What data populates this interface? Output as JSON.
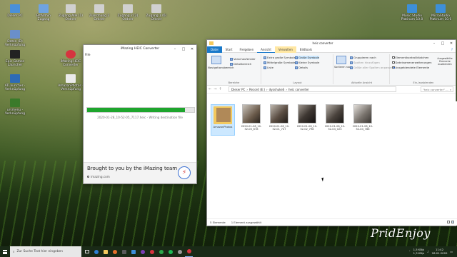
{
  "desktop": {
    "icons": [
      {
        "label": "Dieser PC",
        "color": "#4a90d9"
      },
      {
        "label": "BitAdmin Zugang",
        "color": "#6fa3e0"
      },
      {
        "label": "Zugang Alle (1) Ordner",
        "color": "#d0d0d0"
      },
      {
        "label": "Zuordnung 2 Ordner",
        "color": "#d0d0d0"
      },
      {
        "label": "Zugang 2 (2) Ordner",
        "color": "#d0d0d0"
      },
      {
        "label": "Zugang 1 (6) Ordner",
        "color": "#d0d0d0"
      },
      {
        "label": "Daten (D) Verknüpfung",
        "color": "#6a8fc9"
      },
      {
        "label": "Epic Games Launcher",
        "color": "#222222"
      },
      {
        "label": "iMazing HEIC Converter",
        "color": "#d6343f"
      },
      {
        "label": "ATLauncher - Verknüpfung",
        "color": "#2e6bb5"
      },
      {
        "label": "AmazonPhotos - Verknüpfung",
        "color": "#eaeaea"
      },
      {
        "label": "ursmenu - Verknüpfung",
        "color": "#3a7a2a"
      },
      {
        "label": "Music Studio Platinum 10.0",
        "color": "#3d8fd9"
      },
      {
        "label": "MicroStudio Platinum 10.0",
        "color": "#3d8fd9"
      }
    ]
  },
  "imazing": {
    "title": "iMazing HEIC Converter",
    "menu_file": "File",
    "progress": 0.91,
    "status": "2020-01-28_10-52-05_7117.heic - Writing destination file",
    "brought": "Brought to you by the iMazing team",
    "site": "imazing.com",
    "accent": "#1ea52d"
  },
  "explorer": {
    "title": "heic converter",
    "tabs": {
      "file": "Datei",
      "start": "Start",
      "share": "Freigeben",
      "view": "Ansicht",
      "manage": "Verwalten",
      "pictools": "Bildtools"
    },
    "ribbon": {
      "nav_pane": "Navigationsbereich",
      "preview": "Vorschaufenster",
      "details_pane": "Detailbereich",
      "xl_icons": "Extra große Symbole",
      "l_icons": "Große Symbole",
      "m_icons": "Mittelgroße Symbole",
      "s_icons": "Kleine Symbole",
      "list": "Liste",
      "details": "Details",
      "sort": "Sortieren nach",
      "group": "Gruppieren nach",
      "add_cols": "Spalten hinzufügen",
      "fit_cols": "Größe aller Spalten anpassen",
      "chk_boxes": "Elementkontrollkästchen",
      "ext": "Dateinamenerweiterungen",
      "hidden": "Ausgeblendete Elemente",
      "hide_sel": "Ausgewählte Elemente ausblenden",
      "options": "Optionen",
      "g_panes": "Bereiche",
      "g_layout": "Layout",
      "g_view": "Aktuelle Ansicht",
      "g_show": "Ein-/ausblenden"
    },
    "breadcrumb": [
      "Dieser PC",
      "Record (E:)",
      "dyoshukeS",
      "heic converter"
    ],
    "search_placeholder": "\"heic converter\" ...",
    "items": [
      {
        "name": "AmazonPhotos",
        "type": "folder"
      },
      {
        "name": "2020-01-28_10-52-00_678",
        "type": "image",
        "tone": "#6a5a4a"
      },
      {
        "name": "2020-01-28_10-52-01_747",
        "type": "image",
        "tone": "#5a4d42"
      },
      {
        "name": "2020-01-28_10-52-02_798",
        "type": "image",
        "tone": "#3f3833"
      },
      {
        "name": "2020-01-28_10-52-04_023",
        "type": "image",
        "tone": "#4a433d"
      },
      {
        "name": "2020-01-28_10-52-04_786",
        "type": "image",
        "tone": "#7a746e"
      }
    ],
    "status_count": "5 Elemente",
    "status_sel": "1 Element ausgewählt"
  },
  "taskbar": {
    "search": "Zur Suche Text hier eingeben",
    "net_up": "1,5 KB/s",
    "net_down": "1,3 KB/s",
    "time": "11:42",
    "date": "28.01.2020"
  },
  "watermark": "PridEnjoy"
}
